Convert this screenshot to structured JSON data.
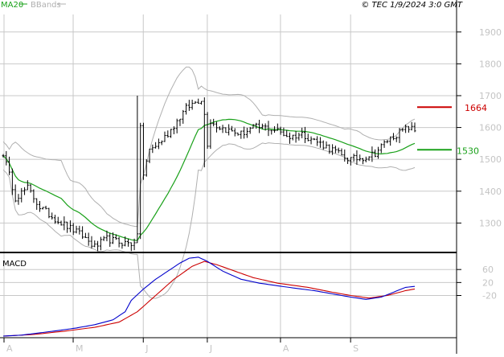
{
  "header": {
    "legend": [
      {
        "label": "MA20",
        "color": "#1aa11a"
      },
      {
        "label": "BBands",
        "color": "#b0b0b0"
      }
    ],
    "copyright": "© TEC 1/9/2024 3:0 GMT"
  },
  "colors": {
    "price_bars": "#000000",
    "ma20": "#1aa11a",
    "bbands": "#b0b0b0",
    "resistance": "#cc0000",
    "support": "#1aa11a",
    "macd": "#0000cc",
    "signal": "#cc0000",
    "grid": "#c8c8c8",
    "axis_label": "#c4c4c4"
  },
  "chart_data": [
    {
      "type": "line",
      "panel": "price",
      "x_labels": [
        "A",
        "M",
        "J",
        "J",
        "A",
        "S"
      ],
      "y_ticks": [
        1300,
        1400,
        1500,
        1600,
        1700,
        1800,
        1900
      ],
      "ylim": [
        1210,
        1955
      ],
      "series_names": {
        "price": "",
        "ma": "MA20",
        "bands": "BBands"
      },
      "anchors": [
        [
          0,
          1520
        ],
        [
          4,
          1380
        ],
        [
          8,
          1410
        ],
        [
          12,
          1350
        ],
        [
          16,
          1320
        ],
        [
          20,
          1295
        ],
        [
          26,
          1260
        ],
        [
          30,
          1225
        ],
        [
          34,
          1250
        ],
        [
          38,
          1240
        ],
        [
          42,
          1235
        ],
        [
          44,
          1255
        ],
        [
          45,
          1610
        ],
        [
          46,
          1450
        ],
        [
          48,
          1530
        ],
        [
          51,
          1550
        ],
        [
          54,
          1580
        ],
        [
          57,
          1620
        ],
        [
          60,
          1660
        ],
        [
          63,
          1680
        ],
        [
          65,
          1690
        ],
        [
          66,
          1640
        ],
        [
          67,
          1550
        ],
        [
          68,
          1620
        ],
        [
          70,
          1605
        ],
        [
          74,
          1590
        ],
        [
          78,
          1580
        ],
        [
          82,
          1600
        ],
        [
          86,
          1600
        ],
        [
          90,
          1590
        ],
        [
          94,
          1570
        ],
        [
          98,
          1580
        ],
        [
          102,
          1560
        ],
        [
          106,
          1540
        ],
        [
          109,
          1525
        ],
        [
          111,
          1510
        ],
        [
          114,
          1500
        ],
        [
          118,
          1505
        ],
        [
          122,
          1520
        ],
        [
          126,
          1560
        ],
        [
          130,
          1585
        ],
        [
          133,
          1600
        ],
        [
          135,
          1590
        ]
      ],
      "spikes": [
        [
          44,
          1700
        ],
        [
          66,
          1475
        ]
      ],
      "resistance": {
        "value": 1664,
        "label": "1664",
        "color": "#cc0000"
      },
      "support": {
        "value": 1530,
        "label": "1530",
        "color": "#1aa11a"
      },
      "grid": true
    },
    {
      "type": "line",
      "panel": "macd",
      "title": "MACD",
      "y_ticks": [
        60,
        20,
        -20
      ],
      "y_tick_labels": [
        "60",
        "20",
        "-20"
      ],
      "ylim": [
        -150,
        110
      ],
      "macd": [
        [
          0,
          -145
        ],
        [
          6,
          -142
        ],
        [
          12,
          -135
        ],
        [
          18,
          -128
        ],
        [
          24,
          -120
        ],
        [
          30,
          -110
        ],
        [
          36,
          -95
        ],
        [
          40,
          -70
        ],
        [
          42,
          -35
        ],
        [
          46,
          0
        ],
        [
          50,
          30
        ],
        [
          54,
          55
        ],
        [
          58,
          80
        ],
        [
          61,
          95
        ],
        [
          64,
          98
        ],
        [
          67,
          85
        ],
        [
          72,
          55
        ],
        [
          78,
          30
        ],
        [
          84,
          18
        ],
        [
          90,
          10
        ],
        [
          96,
          2
        ],
        [
          102,
          -5
        ],
        [
          108,
          -15
        ],
        [
          114,
          -25
        ],
        [
          119,
          -32
        ],
        [
          124,
          -25
        ],
        [
          128,
          -10
        ],
        [
          132,
          5
        ],
        [
          135,
          8
        ]
      ],
      "signal": [
        [
          0,
          -145
        ],
        [
          10,
          -140
        ],
        [
          20,
          -130
        ],
        [
          30,
          -118
        ],
        [
          38,
          -102
        ],
        [
          44,
          -70
        ],
        [
          50,
          -20
        ],
        [
          56,
          30
        ],
        [
          62,
          70
        ],
        [
          66,
          85
        ],
        [
          70,
          75
        ],
        [
          76,
          55
        ],
        [
          82,
          35
        ],
        [
          90,
          18
        ],
        [
          100,
          5
        ],
        [
          108,
          -10
        ],
        [
          114,
          -20
        ],
        [
          120,
          -28
        ],
        [
          126,
          -20
        ],
        [
          132,
          -5
        ],
        [
          135,
          0
        ]
      ],
      "grid": true
    }
  ]
}
